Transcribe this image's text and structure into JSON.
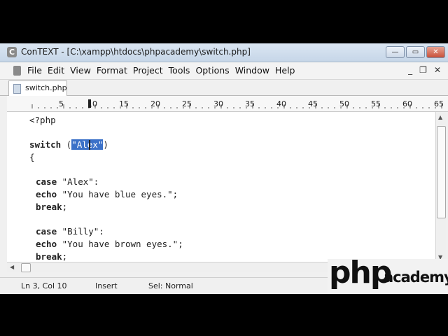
{
  "window": {
    "title": "ConTEXT - [C:\\xampp\\htdocs\\phpacademy\\switch.php]",
    "controls": {
      "minimize": "—",
      "maximize": "▭",
      "close": "✕"
    }
  },
  "menubar": {
    "items": [
      "File",
      "Edit",
      "View",
      "Format",
      "Project",
      "Tools",
      "Options",
      "Window",
      "Help"
    ],
    "doc_controls": {
      "minimize": "_",
      "restore": "❐",
      "close": "✕"
    }
  },
  "tabs": [
    {
      "label": "switch.php",
      "active": true
    }
  ],
  "ruler": {
    "labels": [
      "5",
      "10",
      "15",
      "20",
      "25",
      "30",
      "35",
      "40",
      "45",
      "50",
      "55",
      "60",
      "65"
    ]
  },
  "editor": {
    "lines": {
      "l1": "<?php",
      "l3_kw": "switch",
      "l3_open": " (",
      "l3_sel": "\"Alex\"",
      "l3_close": ")",
      "l4": "{",
      "l6_kw": "case",
      "l6_rest": " \"Alex\":",
      "l7_kw": "echo",
      "l7_rest": " \"You have blue eyes.\";",
      "l8_kw": "break",
      "l8_rest": ";",
      "l10_kw": "case",
      "l10_rest": " \"Billy\":",
      "l11_kw": "echo",
      "l11_rest": " \"You have brown eyes.\";",
      "l12_kw": "break",
      "l12_rest": ";"
    },
    "selection_color": "#3b71c8"
  },
  "status": {
    "position": "Ln 3, Col 10",
    "mode": "Insert",
    "sel": "Sel: Normal"
  },
  "logo": {
    "php": "php",
    "academy": "academy"
  }
}
